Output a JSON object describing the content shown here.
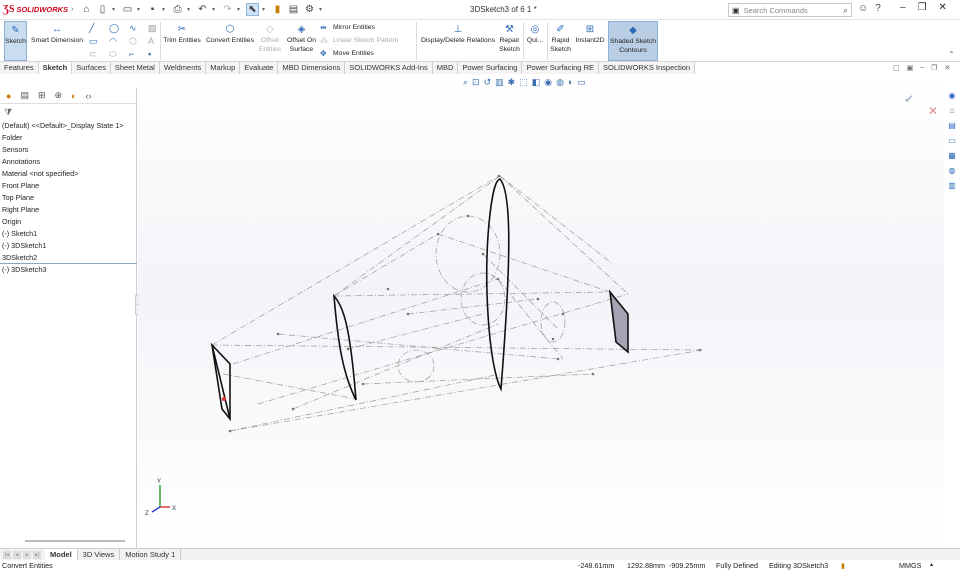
{
  "app": {
    "logo_text": "SOLIDWORKS",
    "title": "3DSketch3 of 6 1 *"
  },
  "search": {
    "placeholder": "Search Commands"
  },
  "ribbon": {
    "sketch": "Sketch",
    "smart_dimension": "Smart Dimension",
    "trim_entities": "Trim Entities",
    "convert_entities": "Convert Entities",
    "offset_entities": "Offset Entities",
    "offset_on_surface": "Offset On Surface",
    "mirror_entities": "Mirror Entities",
    "linear_sketch_pattern": "Linear Sketch Pattern",
    "move_entities": "Move Entities",
    "display_delete_relations": "Display/Delete Relations",
    "repair_sketch": "Repair Sketch",
    "quick_snaps": "Qui...",
    "rapid_sketch": "Rapid Sketch",
    "instant2d": "Instant2D",
    "shaded_sketch_contours": "Shaded Sketch Contours"
  },
  "tabs": [
    "Features",
    "Sketch",
    "Surfaces",
    "Sheet Metal",
    "Weldments",
    "Markup",
    "Evaluate",
    "MBD Dimensions",
    "SOLIDWORKS Add-Ins",
    "MBD",
    "Power Surfacing",
    "Power Surfacing RE",
    "SOLIDWORKS Inspection"
  ],
  "active_tab": "Sketch",
  "tree": [
    "(Default) <<Default>_Display State 1>",
    "Folder",
    "Sensors",
    "Annotations",
    "Material <not specified>",
    "Front Plane",
    "Top Plane",
    "Right Plane",
    "Origin",
    "(-) Sketch1",
    "(-) 3DSketch1",
    "3DSketch2",
    "(-) 3DSketch3"
  ],
  "bottom_tabs": [
    "Model",
    "3D Views",
    "Motion Study 1"
  ],
  "status": {
    "hint": "Convert Entities",
    "x": "-248.61mm",
    "y": "1292.88mm",
    "z": "-909.25mm",
    "state": "Fully Defined",
    "editing": "Editing 3DSketch3",
    "units": "MMGS"
  },
  "triad": {
    "x": "X",
    "y": "Y",
    "z": "Z"
  },
  "colors": {
    "accent": "#2a6bb8",
    "brand": "#d0021b",
    "active_bg": "#c9dcf0"
  }
}
